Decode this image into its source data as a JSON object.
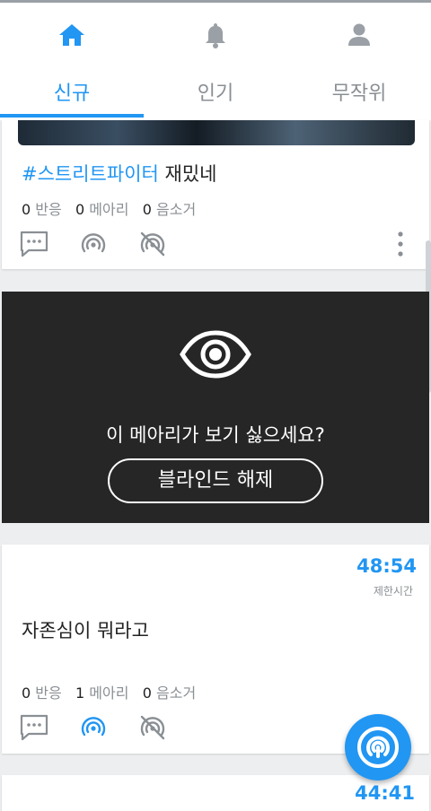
{
  "header": {
    "icons": [
      "home-icon",
      "bell-icon",
      "person-icon"
    ],
    "tabs": [
      {
        "label": "신규",
        "active": true
      },
      {
        "label": "인기",
        "active": false
      },
      {
        "label": "무작위",
        "active": false
      }
    ]
  },
  "colors": {
    "accent": "#2196f3",
    "muted": "#8a8f94",
    "blind_bg": "#262626"
  },
  "posts": [
    {
      "hashtag": "#스트리트파이터",
      "title": "재밌네",
      "stats": {
        "reactions": "0",
        "reactions_label": "반응",
        "echoes": "0",
        "echoes_label": "메아리",
        "erase": "0",
        "erase_label": "음소거"
      }
    },
    {
      "timer": "48:54",
      "timer_label": "제한시간",
      "title": "자존심이 뭐라고",
      "stats": {
        "reactions": "0",
        "reactions_label": "반응",
        "echoes": "1",
        "echoes_label": "메아리",
        "erase": "0",
        "erase_label": "음소거"
      }
    },
    {
      "timer": "44:41"
    }
  ],
  "blinded": {
    "question": "이 메아리가 보기 싫으세요?",
    "button_label": "블라인드 해제"
  },
  "fab_icon": "echo-icon"
}
